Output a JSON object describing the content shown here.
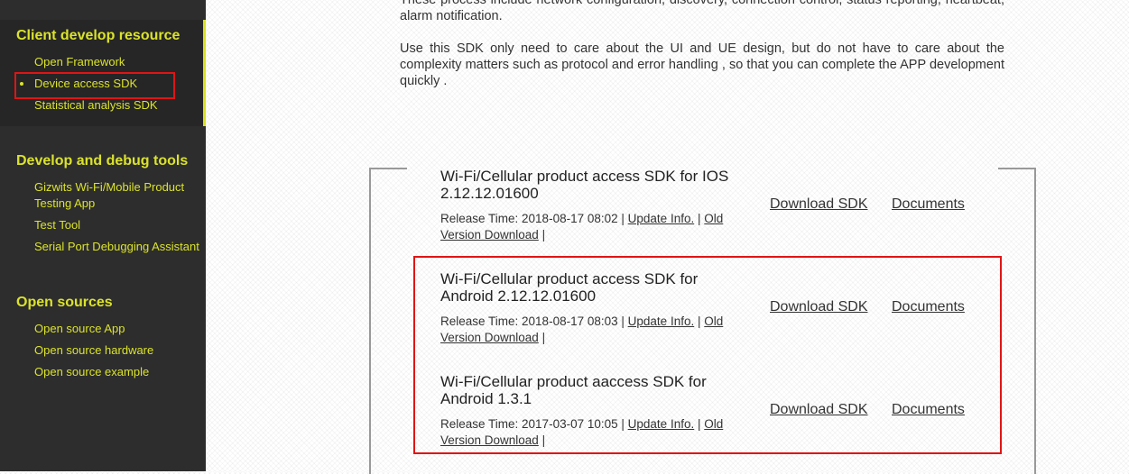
{
  "colors": {
    "sidebar_bg": "#2d2d2d",
    "accent": "#dbe32a",
    "highlight": "#e01515"
  },
  "sidebar": {
    "sections": [
      {
        "title": "Client develop resource",
        "items": [
          "Open Framework",
          "Device access SDK",
          "Statistical analysis SDK"
        ],
        "active_item": "Device access SDK"
      },
      {
        "title": "Develop and debug tools",
        "items": [
          "Gizwits Wi-Fi/Mobile Product Testing App",
          "Test Tool",
          "Serial Port Debugging Assistant"
        ]
      },
      {
        "title": "Open sources",
        "items": [
          "Open source App",
          "Open source hardware",
          "Open source example"
        ]
      }
    ]
  },
  "intro": {
    "p1": "These process include network configuration, discovery, connection control, status reporting, heartbeat, alarm notification.",
    "p2": "Use this SDK only need to care about the UI and UE design, but do not have to care about the complexity matters such as protocol and error handling , so that you can complete the APP development quickly ."
  },
  "sdks": [
    {
      "title": "Wi-Fi/Cellular product access SDK for IOS 2.12.12.01600",
      "release_label": "Release Time: 2018-08-17 08:02 |",
      "update_label": "Update Info.",
      "old_label": "Old Version Download",
      "download_label": "Download SDK",
      "docs_label": "Documents"
    },
    {
      "title": "Wi-Fi/Cellular product access SDK for Android 2.12.12.01600",
      "release_label": "Release Time: 2018-08-17 08:03 |",
      "update_label": "Update Info.",
      "old_label": "Old Version Download",
      "download_label": "Download SDK",
      "docs_label": "Documents"
    },
    {
      "title": "Wi-Fi/Cellular product aaccess SDK for Android 1.3.1",
      "release_label": "Release Time: 2017-03-07 10:05 |",
      "update_label": "Update Info.",
      "old_label": "Old Version Download",
      "download_label": "Download SDK",
      "docs_label": "Documents"
    }
  ],
  "separator": "|"
}
